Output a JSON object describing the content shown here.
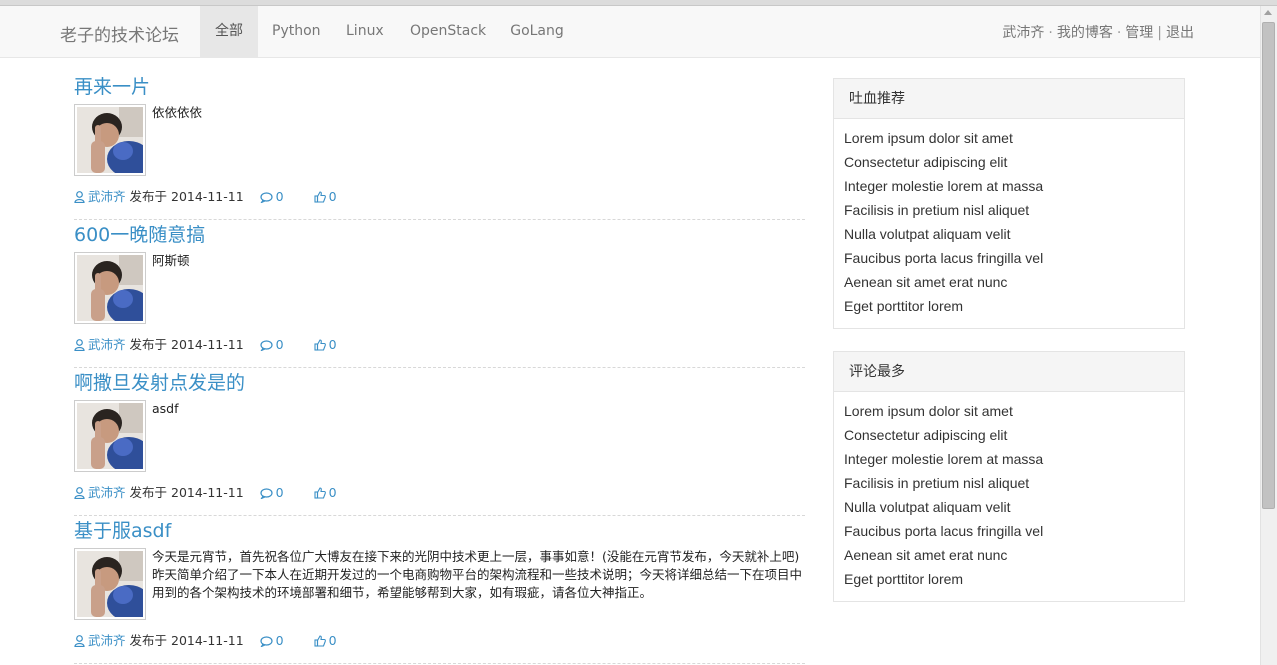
{
  "nav": {
    "brand": "老子的技术论坛",
    "tabs": [
      {
        "label": "全部",
        "active": true
      },
      {
        "label": "Python",
        "active": false
      },
      {
        "label": "Linux",
        "active": false
      },
      {
        "label": "OpenStack",
        "active": false
      },
      {
        "label": "GoLang",
        "active": false
      }
    ],
    "user": "武沛齐",
    "dot": "·",
    "blog": "我的博客",
    "admin": "管理",
    "pipe": "|",
    "logout": "退出"
  },
  "posts": [
    {
      "title": "再来一片",
      "summary": "依依依依",
      "author": "武沛齐",
      "published_label": "发布于",
      "date": "2014-11-11",
      "comments": "0",
      "likes": "0"
    },
    {
      "title": "600一晚随意搞",
      "summary": "阿斯顿",
      "author": "武沛齐",
      "published_label": "发布于",
      "date": "2014-11-11",
      "comments": "0",
      "likes": "0"
    },
    {
      "title": "啊撒旦发射点发是的",
      "summary": "asdf",
      "author": "武沛齐",
      "published_label": "发布于",
      "date": "2014-11-11",
      "comments": "0",
      "likes": "0"
    },
    {
      "title": "基于服asdf",
      "summary": "今天是元宵节，首先祝各位广大博友在接下来的光阴中技术更上一层，事事如意！(没能在元宵节发布，今天就补上吧) 昨天简单介绍了一下本人在近期开发过的一个电商购物平台的架构流程和一些技术说明；今天将详细总结一下在项目中用到的各个架构技术的环境部署和细节，希望能够帮到大家，如有瑕疵，请各位大神指正。",
      "author": "武沛齐",
      "published_label": "发布于",
      "date": "2014-11-11",
      "comments": "0",
      "likes": "0"
    }
  ],
  "sidebar": {
    "recommended": {
      "title": "吐血推荐",
      "items": [
        "Lorem ipsum dolor sit amet",
        "Consectetur adipiscing elit",
        "Integer molestie lorem at massa",
        "Facilisis in pretium nisl aliquet",
        "Nulla volutpat aliquam velit",
        "Faucibus porta lacus fringilla vel",
        "Aenean sit amet erat nunc",
        "Eget porttitor lorem"
      ]
    },
    "most_comments": {
      "title": "评论最多",
      "items": [
        "Lorem ipsum dolor sit amet",
        "Consectetur adipiscing elit",
        "Integer molestie lorem at massa",
        "Facilisis in pretium nisl aliquet",
        "Nulla volutpat aliquam velit",
        "Faucibus porta lacus fringilla vel",
        "Aenean sit amet erat nunc",
        "Eget porttitor lorem"
      ]
    }
  },
  "icons": {
    "author": "user-icon",
    "comments": "comment-icon",
    "likes": "thumbs-up-icon"
  },
  "colors": {
    "link": "#3a8fc6",
    "navbar_bg": "#f8f8f8",
    "active_tab_bg": "#e7e7e7"
  }
}
